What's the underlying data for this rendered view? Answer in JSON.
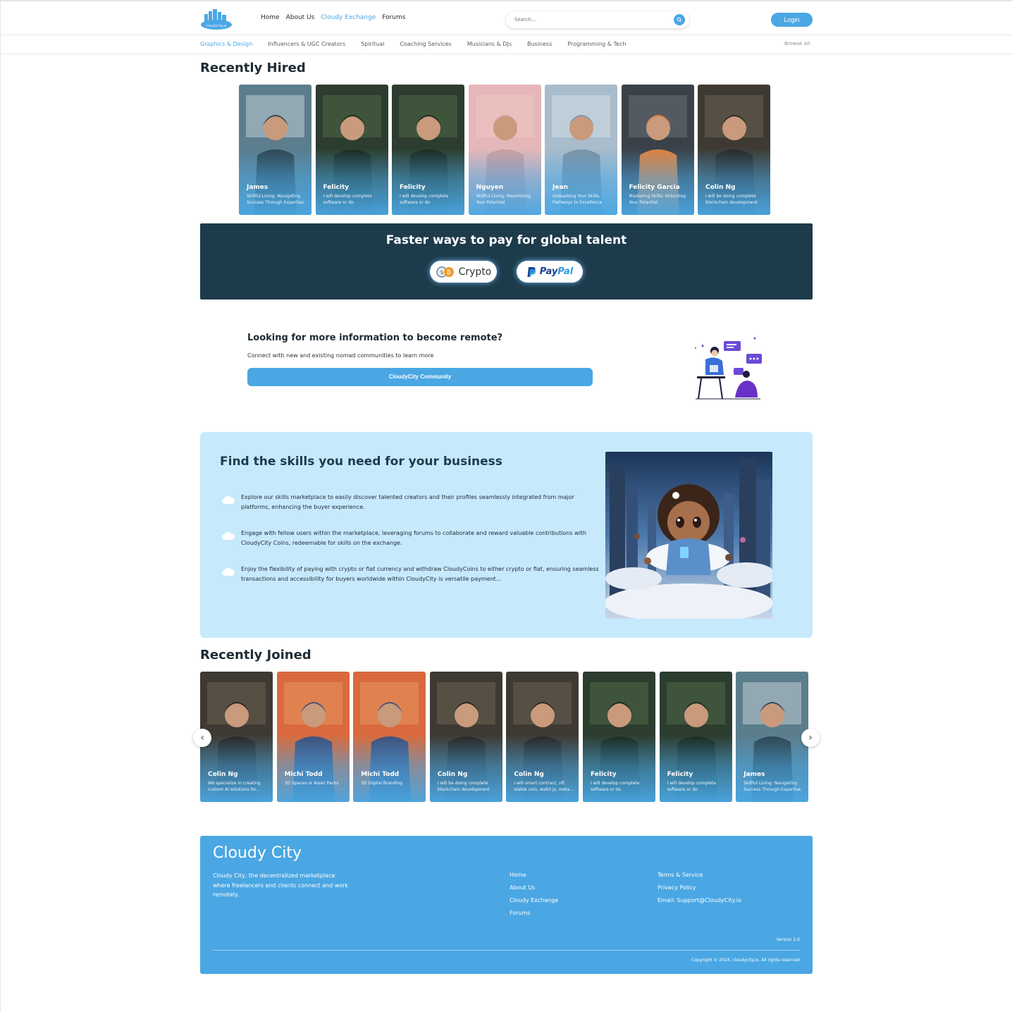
{
  "header": {
    "logo_text": "CloudyCity.io",
    "nav": [
      "Home",
      "About Us",
      "Cloudy Exchange",
      "Forums"
    ],
    "active_nav": "Cloudy Exchange",
    "search_placeholder": "Search...",
    "login_label": "Login",
    "accent_color": "#4aa7e3"
  },
  "categories": {
    "items": [
      "Graphics & Design",
      "Influencers & UGC Creators",
      "Spiritual",
      "Coaching Services",
      "Musicians & DJs",
      "Business",
      "Programming & Tech"
    ],
    "active": "Graphics & Design",
    "browse_all": "Browse All"
  },
  "recently_hired": {
    "title": "Recently Hired",
    "cards": [
      {
        "name": "James",
        "desc": "Skillful Living: Navigating Success Through Expertise"
      },
      {
        "name": "Felicity",
        "desc": "I will develop complete software or do customizatio..."
      },
      {
        "name": "Felicity",
        "desc": "I will develop complete software or do customizatio..."
      },
      {
        "name": "Nguyen",
        "desc": "Skillful Living: Maximizing Your Potential"
      },
      {
        "name": "Jean",
        "desc": "Unleashing Your Skills: Pathways to Excellence"
      },
      {
        "name": "Felicity Garcia",
        "desc": "Mastering Skills: Unlocking Your Potential"
      },
      {
        "name": "Colin Ng",
        "desc": "I will be doing complete blockchain development"
      }
    ]
  },
  "pay_banner": {
    "title": "Faster ways to pay for global talent",
    "crypto_label": "Crypto",
    "paypal_a": "Pay",
    "paypal_b": "Pal",
    "bg_color": "#1d3b4b"
  },
  "info": {
    "title": "Looking for more information to become remote?",
    "subtitle": "Connect with new and existing nomad communities to learn more",
    "button": "CloudyCity Community"
  },
  "skills": {
    "title": "Find the skills you need for your business",
    "bullets": [
      "Explore our skills marketplace to easily discover talented creators and their profiles seamlessly integrated from major platforms, enhancing the buyer experience.",
      "Engage with fellow users within the marketplace, leveraging forums to collaborate and reward valuable contributions with CloudyCity Coins, redeemable for skills on the exchange.",
      "Enjoy the flexibility of paying with crypto or fiat currency and withdraw CloudyCoins to either crypto or fiat, ensuring seamless transactions and accessibility for buyers worldwide within CloudyCity is versatile payment..."
    ],
    "bg_color": "#c6e9fc"
  },
  "recently_joined": {
    "title": "Recently Joined",
    "prev": "‹",
    "next": "›",
    "cards": [
      {
        "name": "Colin Ng",
        "desc": "We specialize in creating custom AI solutions for..."
      },
      {
        "name": "Michi Todd",
        "desc": "3D Spaces or Asset Packs"
      },
      {
        "name": "Michi Todd",
        "desc": "3D Digital Branding"
      },
      {
        "name": "Colin Ng",
        "desc": "I will be doing complete blockchain development"
      },
      {
        "name": "Colin Ng",
        "desc": "I will smart contract, nft stable coin, web3 js, meta..."
      },
      {
        "name": "Felicity",
        "desc": "I will develop complete software or do customizatio..."
      },
      {
        "name": "Felicity",
        "desc": "I will develop complete software or do customizatio..."
      },
      {
        "name": "James",
        "desc": "Skillful Living: Navigating Success Through Expertise"
      }
    ]
  },
  "footer": {
    "brand": "Cloudy City",
    "tagline": "Cloudy City, the decentralized marketplace where freelancers and clients connect and work remotely.",
    "col1": [
      "Home",
      "About Us",
      "Cloudy Exchange",
      "Forums"
    ],
    "col2": [
      "Terms & Service",
      "Privacy Policy",
      "Email: Support@CloudyCity.io"
    ],
    "version": "Version 1.0",
    "copyright": "Copyright © 2024, cloudycity.io. All rights reserved"
  }
}
